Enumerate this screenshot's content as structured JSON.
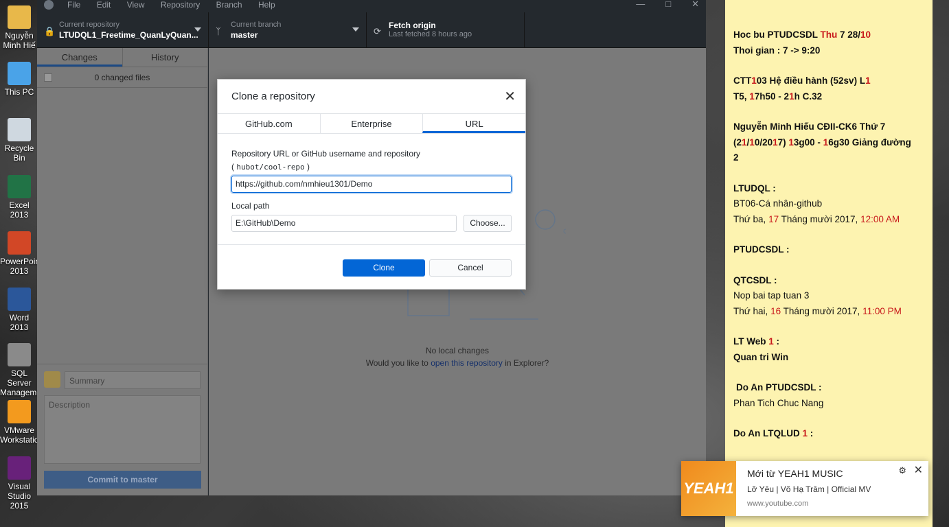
{
  "desktop": {
    "icons": [
      {
        "label": "Nguyễn Minh Hiế"
      },
      {
        "label": "This PC"
      },
      {
        "label": "Recycle Bin"
      },
      {
        "label": "Excel 2013"
      },
      {
        "label": "PowerPoint 2013"
      },
      {
        "label": "Word 2013"
      },
      {
        "label": "SQL Server Management"
      },
      {
        "label": "VMware Workstation"
      },
      {
        "label": "Visual Studio 2015"
      }
    ]
  },
  "app": {
    "menu": [
      "File",
      "Edit",
      "View",
      "Repository",
      "Branch",
      "Help"
    ],
    "toolbar": {
      "repo_small": "Current repository",
      "repo_name": "LTUDQL1_Freetime_QuanLyQuan...",
      "branch_small": "Current branch",
      "branch_name": "master",
      "fetch_title": "Fetch origin",
      "fetch_sub": "Last fetched 8 hours ago"
    },
    "sidebar": {
      "tab_changes": "Changes",
      "tab_history": "History",
      "changed_files": "0 changed files",
      "summary_placeholder": "Summary",
      "description_placeholder": "Description",
      "commit_button": "Commit to master"
    },
    "main": {
      "empty_title": "No local changes",
      "empty_prefix": "Would you like to ",
      "empty_link": "open this repository",
      "empty_suffix": " in Explorer?"
    }
  },
  "dialog": {
    "title": "Clone a repository",
    "tabs": [
      "GitHub.com",
      "Enterprise",
      "URL"
    ],
    "active_tab": "URL",
    "url_label": "Repository URL or GitHub username and repository",
    "hint_open": "( ",
    "hint_code": "hubot/cool-repo",
    "hint_close": " )",
    "url_value": "https://github.com/nmhieu1301/Demo",
    "path_label": "Local path",
    "path_value": "E:\\GitHub\\Demo",
    "choose_button": "Choose...",
    "clone_button": "Clone",
    "cancel_button": "Cancel"
  },
  "sticky": {
    "l1a": "Hoc bu PTUDCSDL ",
    "l1b": "Thu",
    "l1c": " 7  28/",
    "l1d": "10",
    "l2": "Thoi gian : 7 -> 9:20",
    "l3a": "CTT",
    "l3b": "1",
    "l3c": "03 Hệ điều hành (52sv) L",
    "l3d": "1",
    "l4a": "T5, ",
    "l4b": "1",
    "l4c": "7h50 - 2",
    "l4d": "1",
    "l4e": "h C.32",
    "l5": "Nguyễn Minh Hiếu CĐII-CK6 Thứ 7",
    "l6a": "(2",
    "l6b": "1",
    "l6c": "/",
    "l6d": "1",
    "l6e": "0/20",
    "l6f": "1",
    "l6g": "7) ",
    "l6h": "1",
    "l6i": "3g00 - ",
    "l6j": "1",
    "l6k": "6g30 Giảng đường",
    "l7": "2",
    "l8": "LTUDQL :",
    "l9": "BT06-Cá nhân-github",
    "l10a": "Thứ ba, ",
    "l10b": "17",
    "l10c": " Tháng mười 2017, ",
    "l10d": "12:00 AM",
    "l11": "PTUDCSDL :",
    "l12": "QTCSDL :",
    "l13": "Nop bai tap tuan 3",
    "l14a": "Thứ hai, ",
    "l14b": "16",
    "l14c": " Tháng mười 2017, ",
    "l14d": "11:00 PM",
    "l15a": "LT Web ",
    "l15b": "1",
    "l15c": " :",
    "l16": "Quan tri Win",
    "l17": "Do An PTUDCSDL :",
    "l18": "Phan Tich Chuc Nang",
    "l19a": "Do An LTQLUD ",
    "l19b": "1",
    "l19c": " :"
  },
  "toast": {
    "thumb_text": "YEAH1",
    "title": "Mới từ YEAH1 MUSIC",
    "body": "Lỡ Yêu | Võ Hạ Trâm | Official MV",
    "source": "www.youtube.com"
  },
  "colors": {
    "accent": "#0366d6",
    "note_bg": "#fdf3b0",
    "note_red": "#c8181b",
    "app_dark": "#24292e"
  }
}
